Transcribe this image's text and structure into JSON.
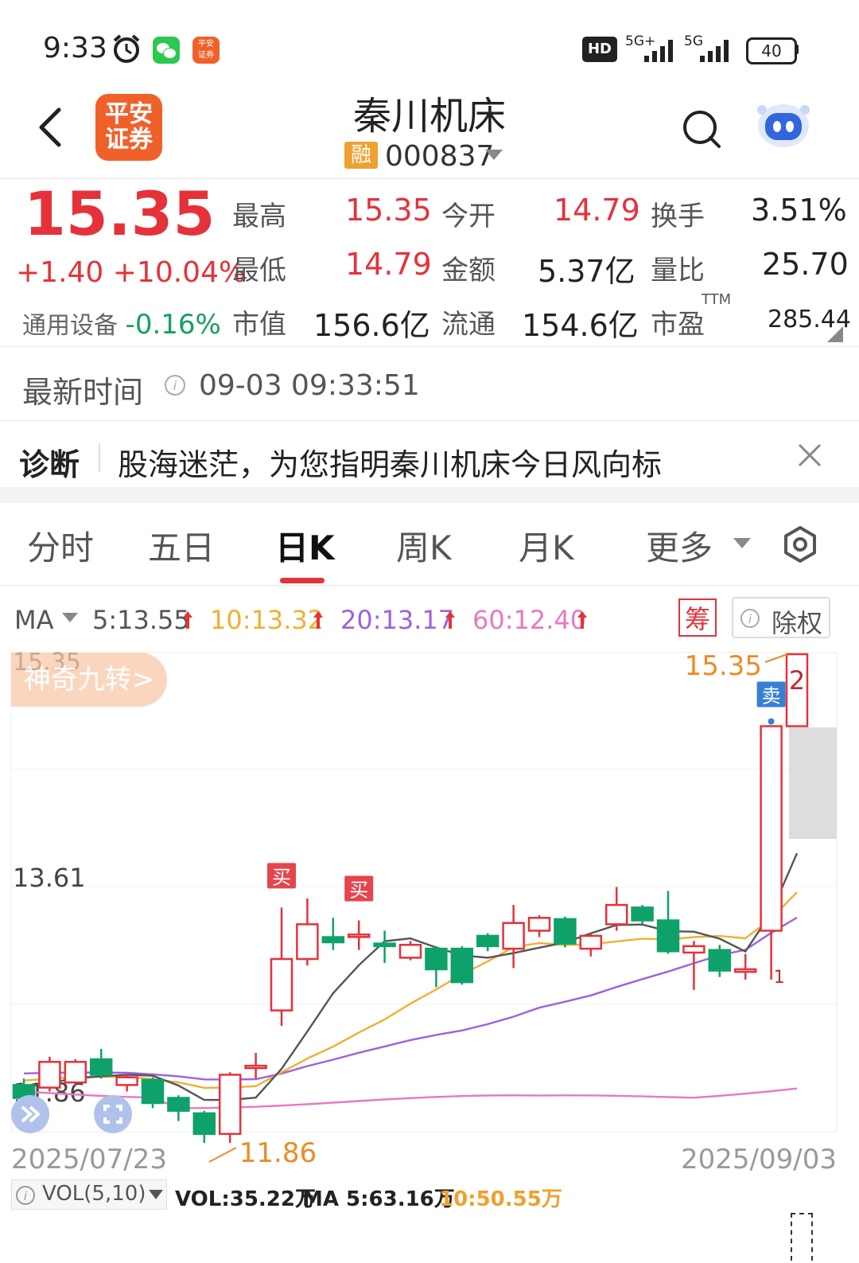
{
  "status_bar": {
    "time": "9:33",
    "hd_label": "HD",
    "net1": "5G+",
    "net2": "5G",
    "battery": "40",
    "icons": [
      "alarm-clock-icon",
      "wechat-icon",
      "pingan-app-icon",
      "signal-icon",
      "battery-icon"
    ]
  },
  "header": {
    "logo_line1": "平安",
    "logo_line2": "证券",
    "stock_name": "秦川机床",
    "margin_badge": "融",
    "stock_code": "000837"
  },
  "quote": {
    "price": "15.35",
    "change": "+1.40 +10.04%",
    "sector_name": "通用设备",
    "sector_change": "-0.16%",
    "fields": [
      {
        "label": "最高",
        "value": "15.35"
      },
      {
        "label": "今开",
        "value": "14.79"
      },
      {
        "label": "换手",
        "value": "3.51%"
      },
      {
        "label": "最低",
        "value": "14.79"
      },
      {
        "label": "金额",
        "value": "5.37亿"
      },
      {
        "label": "量比",
        "value": "25.70"
      },
      {
        "label": "市值",
        "value": "156.6亿"
      },
      {
        "label": "流通",
        "value": "154.6亿"
      },
      {
        "label": "市盈",
        "value": "285.44"
      }
    ],
    "ttm_label": "TTM"
  },
  "update_time": {
    "label": "最新时间",
    "value": "09-03 09:33:51"
  },
  "diagnosis": {
    "label": "诊断",
    "text": "股海迷茫，为您指明秦川机床今日风向标"
  },
  "chart_tabs": {
    "items": [
      "分时",
      "五日",
      "日K",
      "周K",
      "月K",
      "更多"
    ],
    "active": "日K"
  },
  "ma_bar": {
    "label": "MA",
    "ma5": "5:13.55",
    "ma10": "10:13.32",
    "ma20": "20:13.17",
    "ma60": "60:12.40",
    "chip_label": "筹",
    "exright_label": "除权"
  },
  "colors": {
    "up": "#e5323a",
    "down": "#0ea26a",
    "ma5": "#555555",
    "ma10": "#f0b030",
    "ma20": "#a060e0",
    "ma60": "#e878c0",
    "accent_orange": "#f08a24"
  },
  "chart_data": {
    "type": "candlestick",
    "y_axis_labels": [
      "15.35",
      "13.61",
      "11.86"
    ],
    "high_marker": "15.35",
    "low_marker": "11.86",
    "x_start": "2025/07/23",
    "x_end": "2025/09/03",
    "ylim": [
      11.86,
      15.35
    ],
    "candles": [
      {
        "open": 12.0,
        "close": 11.9,
        "high": 12.05,
        "low": 11.8
      },
      {
        "open": 11.98,
        "close": 12.18,
        "high": 12.22,
        "low": 11.95
      },
      {
        "open": 12.02,
        "close": 12.18,
        "high": 12.2,
        "low": 12.0
      },
      {
        "open": 12.2,
        "close": 12.08,
        "high": 12.28,
        "low": 12.05
      },
      {
        "open": 12.0,
        "close": 12.06,
        "high": 12.08,
        "low": 11.95
      },
      {
        "open": 12.04,
        "close": 11.86,
        "high": 12.06,
        "low": 11.82
      },
      {
        "open": 11.9,
        "close": 11.8,
        "high": 11.92,
        "low": 11.72
      },
      {
        "open": 11.78,
        "close": 11.62,
        "high": 11.8,
        "low": 11.55
      },
      {
        "open": 11.62,
        "close": 12.08,
        "high": 12.1,
        "low": 11.55
      },
      {
        "open": 12.15,
        "close": 12.15,
        "high": 12.25,
        "low": 12.05
      },
      {
        "open": 12.58,
        "close": 12.98,
        "high": 13.38,
        "low": 12.46
      },
      {
        "open": 12.98,
        "close": 13.25,
        "high": 13.45,
        "low": 12.93
      },
      {
        "open": 13.15,
        "close": 13.11,
        "high": 13.3,
        "low": 13.05
      },
      {
        "open": 13.17,
        "close": 13.17,
        "high": 13.28,
        "low": 13.05
      },
      {
        "open": 13.1,
        "close": 13.08,
        "high": 13.2,
        "low": 12.95
      },
      {
        "open": 12.99,
        "close": 13.09,
        "high": 13.12,
        "low": 12.97
      },
      {
        "open": 13.06,
        "close": 12.9,
        "high": 13.08,
        "low": 12.76
      },
      {
        "open": 13.06,
        "close": 12.8,
        "high": 13.08,
        "low": 12.78
      },
      {
        "open": 13.16,
        "close": 13.08,
        "high": 13.18,
        "low": 13.04
      },
      {
        "open": 13.06,
        "close": 13.26,
        "high": 13.4,
        "low": 12.91
      },
      {
        "open": 13.2,
        "close": 13.3,
        "high": 13.32,
        "low": 13.15
      },
      {
        "open": 13.29,
        "close": 13.1,
        "high": 13.31,
        "low": 13.07
      },
      {
        "open": 13.06,
        "close": 13.16,
        "high": 13.18,
        "low": 13.0
      },
      {
        "open": 13.25,
        "close": 13.4,
        "high": 13.54,
        "low": 13.2
      },
      {
        "open": 13.38,
        "close": 13.28,
        "high": 13.4,
        "low": 13.25
      },
      {
        "open": 13.28,
        "close": 13.04,
        "high": 13.51,
        "low": 13.02
      },
      {
        "open": 13.03,
        "close": 13.08,
        "high": 13.12,
        "low": 12.74
      },
      {
        "open": 13.05,
        "close": 12.89,
        "high": 13.09,
        "low": 12.84
      },
      {
        "open": 12.88,
        "close": 12.9,
        "high": 13.02,
        "low": 12.82
      },
      {
        "open": 13.2,
        "close": 14.79,
        "high": 14.79,
        "low": 12.82
      },
      {
        "open": 14.79,
        "close": 15.35,
        "high": 15.35,
        "low": 14.79
      }
    ],
    "signals": [
      {
        "label": "买",
        "candle": 10
      },
      {
        "label": "买",
        "candle": 13
      },
      {
        "label": "卖",
        "candle": 29
      }
    ],
    "nine_turn_counts": [
      {
        "label": "1",
        "candle": 29
      },
      {
        "label": "2",
        "candle": 30
      }
    ]
  },
  "chart_overlays": {
    "nine_turn_button": "神奇九转>",
    "expand_icons": [
      "double-chevron-icon",
      "fullscreen-icon"
    ]
  },
  "volume_bar": {
    "label": "VOL(5,10)",
    "vol": "VOL:35.22万",
    "ma5": "MA 5:63.16万",
    "ma10": "10:50.55万"
  }
}
